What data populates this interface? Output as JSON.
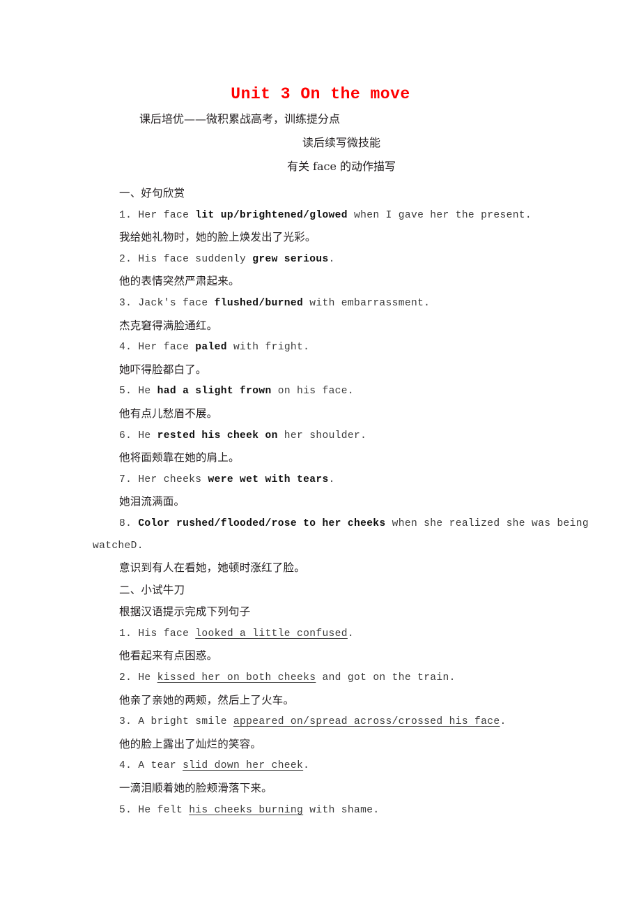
{
  "title": "Unit 3 On the move",
  "title_color": "#ff0000",
  "subheadings": [
    "课后培优——微积累战高考，训练提分点",
    "读后续写微技能",
    "有关 face 的动作描写"
  ],
  "sections": [
    {
      "heading": "一、好句欣赏",
      "items": [
        {
          "number": "1.",
          "en_parts": [
            {
              "text": "1. Her face ",
              "style": "plain"
            },
            {
              "text": "lit up/brightened/glowed",
              "style": "bold"
            },
            {
              "text": " when I gave her the present.",
              "style": "plain"
            }
          ],
          "zh": "我给她礼物时，她的脸上焕发出了光彩。"
        },
        {
          "number": "2.",
          "en_parts": [
            {
              "text": "2. His face suddenly ",
              "style": "plain"
            },
            {
              "text": "grew serious",
              "style": "bold"
            },
            {
              "text": ".",
              "style": "plain"
            }
          ],
          "zh": "他的表情突然严肃起来。"
        },
        {
          "number": "3.",
          "en_parts": [
            {
              "text": "3. Jack's face ",
              "style": "plain"
            },
            {
              "text": "flushed/burned",
              "style": "bold"
            },
            {
              "text": " with embarrassment.",
              "style": "plain"
            }
          ],
          "zh": "杰克窘得满脸通红。"
        },
        {
          "number": "4.",
          "en_parts": [
            {
              "text": "4. Her face ",
              "style": "plain"
            },
            {
              "text": "paled",
              "style": "bold"
            },
            {
              "text": " with fright.",
              "style": "plain"
            }
          ],
          "zh": "她吓得脸都白了。"
        },
        {
          "number": "5.",
          "en_parts": [
            {
              "text": "5. He ",
              "style": "plain"
            },
            {
              "text": "had a slight frown",
              "style": "bold"
            },
            {
              "text": " on his face.",
              "style": "plain"
            }
          ],
          "zh": "他有点儿愁眉不展。"
        },
        {
          "number": "6.",
          "en_parts": [
            {
              "text": "6. He ",
              "style": "plain"
            },
            {
              "text": "rested his cheek on",
              "style": "bold"
            },
            {
              "text": " her shoulder.",
              "style": "plain"
            }
          ],
          "zh": "他将面颊靠在她的肩上。"
        },
        {
          "number": "7.",
          "en_parts": [
            {
              "text": "7. Her cheeks ",
              "style": "plain"
            },
            {
              "text": "were wet with tears",
              "style": "bold"
            },
            {
              "text": ".",
              "style": "plain"
            }
          ],
          "zh": "她泪流满面。"
        },
        {
          "number": "8.",
          "en_parts": [
            {
              "text": "8. ",
              "style": "plain"
            },
            {
              "text": "Color rushed/flooded/rose to her cheeks",
              "style": "bold"
            },
            {
              "text": " when she realized she was being",
              "style": "plain"
            }
          ],
          "en_wrap": "watcheD.",
          "zh": "意识到有人在看她，她顿时涨红了脸。"
        }
      ]
    },
    {
      "heading": "二、小试牛刀",
      "instruction": "根据汉语提示完成下列句子",
      "items": [
        {
          "number": "1.",
          "en_parts": [
            {
              "text": "1. His face ",
              "style": "plain"
            },
            {
              "text": "looked a little confused",
              "style": "underline"
            },
            {
              "text": ".",
              "style": "plain"
            }
          ],
          "zh": "他看起来有点困惑。"
        },
        {
          "number": "2.",
          "en_parts": [
            {
              "text": "2. He ",
              "style": "plain"
            },
            {
              "text": "kissed her on both cheeks",
              "style": "underline"
            },
            {
              "text": " and got on the train.",
              "style": "plain"
            }
          ],
          "zh": "他亲了亲她的两颊，然后上了火车。"
        },
        {
          "number": "3.",
          "en_parts": [
            {
              "text": "3. A bright smile ",
              "style": "plain"
            },
            {
              "text": "appeared on/spread across/crossed his face",
              "style": "underline"
            },
            {
              "text": ".",
              "style": "plain"
            }
          ],
          "zh": "他的脸上露出了灿烂的笑容。"
        },
        {
          "number": "4.",
          "en_parts": [
            {
              "text": "4. A tear ",
              "style": "plain"
            },
            {
              "text": "slid down her cheek",
              "style": "underline"
            },
            {
              "text": ".",
              "style": "plain"
            }
          ],
          "zh": "一滴泪顺着她的脸颊滑落下来。"
        },
        {
          "number": "5.",
          "en_parts": [
            {
              "text": "5. He felt ",
              "style": "plain"
            },
            {
              "text": "his cheeks burning",
              "style": "underline"
            },
            {
              "text": " with shame.",
              "style": "plain"
            }
          ],
          "zh": ""
        }
      ]
    }
  ]
}
